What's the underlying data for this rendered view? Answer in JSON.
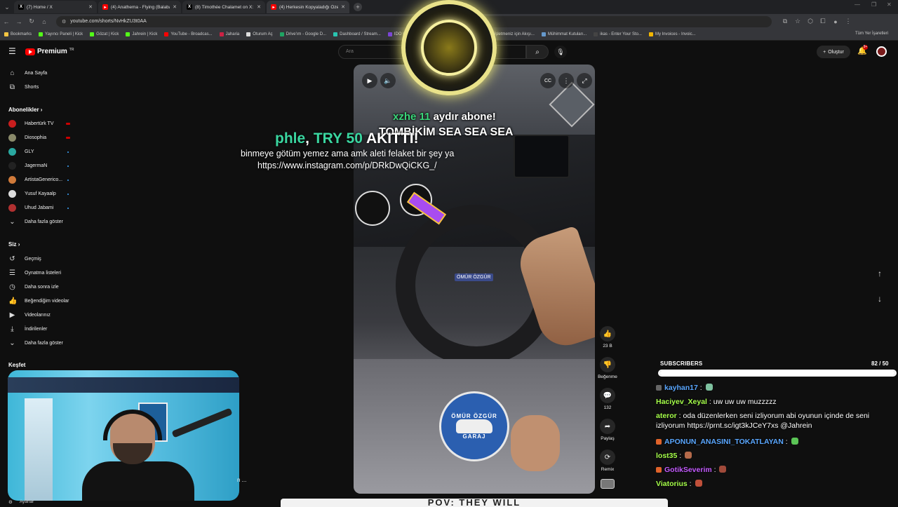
{
  "browser": {
    "tabs": [
      {
        "title": "(7) Home / X",
        "icon": "x-icon",
        "fav_color": "#000000"
      },
      {
        "title": "(4) Anathema - Flying (Balaban",
        "icon": "youtube-icon",
        "fav_color": "#ff0000"
      },
      {
        "title": "(8) Timothée Chalamet on X: \"I",
        "icon": "x-icon",
        "fav_color": "#000000"
      },
      {
        "title": "(4) Herkesin Kopyaladığı Özelli",
        "icon": "youtube-icon",
        "fav_color": "#ff0000"
      }
    ],
    "url": "youtube.com/shorts/NvHkZU3t0AA",
    "bookmarks": [
      {
        "label": "Bookmarks",
        "color": "#f4c542"
      },
      {
        "label": "Yayıncı Paneli | Kick",
        "color": "#53fc18"
      },
      {
        "label": "Gözat | Kick",
        "color": "#53fc18"
      },
      {
        "label": "Jahrein | Kick",
        "color": "#53fc18"
      },
      {
        "label": "YouTube - Broadcas...",
        "color": "#ff0000"
      },
      {
        "label": "Jaharia",
        "color": "#cc2244"
      },
      {
        "label": "Oturum Aç",
        "color": "#dddddd"
      },
      {
        "label": "Drive'ım - Google D...",
        "color": "#1fa463"
      },
      {
        "label": "Dashboard / Stream...",
        "color": "#29c4b0"
      },
      {
        "label": "IDO | SAVAŞÇI...",
        "color": "#7a44d8"
      },
      {
        "label": "Görsel Boyutlarını N...",
        "color": "#e8a33a"
      },
      {
        "label": "İşletmeniz için Akışı...",
        "color": "#dddddd"
      },
      {
        "label": "Mühimmat Kutuları...",
        "color": "#6699cc"
      },
      {
        "label": "ikas - Enter Your Sto...",
        "color": "#444444"
      },
      {
        "label": "My Invoices - Invoic...",
        "color": "#f2b600"
      }
    ],
    "all_bookmarks": "Tüm Yer İşaretleri"
  },
  "header": {
    "logo": "Premium",
    "logo_sup": "TR",
    "search_placeholder": "Ara",
    "create_label": "Oluştur",
    "notif_count": "9+"
  },
  "sidebar": {
    "main": [
      {
        "label": "Ana Sayfa",
        "icon": "home-icon",
        "glyph": "⌂"
      },
      {
        "label": "Shorts",
        "icon": "shorts-icon",
        "glyph": "⧉"
      }
    ],
    "subs_heading": "Abonelikler",
    "subs": [
      {
        "label": "Habertürk TV",
        "color": "#c81e1e",
        "live": true
      },
      {
        "label": "Diosophia",
        "color": "#8a8a6a",
        "live": true
      },
      {
        "label": "GLY",
        "color": "#2aa8a0",
        "live": false
      },
      {
        "label": "JagermaN",
        "color": "#222222",
        "live": false
      },
      {
        "label": "ArtistaGenerico...",
        "color": "#d07a3a",
        "live": false
      },
      {
        "label": "Yusuf Kayaalp",
        "color": "#dddddd",
        "live": false
      },
      {
        "label": "Uhud Jabami",
        "color": "#b03030",
        "live": false
      }
    ],
    "subs_more": "Daha fazla göster",
    "you_heading": "Siz",
    "you": [
      {
        "label": "Geçmiş",
        "icon": "history-icon",
        "glyph": "↺"
      },
      {
        "label": "Oynatma listeleri",
        "icon": "playlist-icon",
        "glyph": "☰"
      },
      {
        "label": "Daha sonra izle",
        "icon": "watch-later-icon",
        "glyph": "◷"
      },
      {
        "label": "Beğendiğim videolar",
        "icon": "like-icon",
        "glyph": "👍"
      },
      {
        "label": "Videolarınız",
        "icon": "your-videos-icon",
        "glyph": "▶"
      },
      {
        "label": "İndirilenler",
        "icon": "download-icon",
        "glyph": "⤓"
      }
    ],
    "you_more": "Daha fazla göster",
    "explore_heading": "Keşfet",
    "settings": "Ayarlar"
  },
  "short": {
    "overlay_badge": "ÖMÜR ÖZGÜR",
    "logo_top": "ÖMÜR ÖZGÜR",
    "logo_bottom": "GARAJ",
    "actions": [
      {
        "icon": "thumbs-up-icon",
        "glyph": "👍",
        "label": "23 B"
      },
      {
        "icon": "thumbs-down-icon",
        "glyph": "👎",
        "label": "Beğenme"
      },
      {
        "icon": "comment-icon",
        "glyph": "💬",
        "label": "132"
      },
      {
        "icon": "share-icon",
        "glyph": "➦",
        "label": "Paylaş"
      },
      {
        "icon": "remix-icon",
        "glyph": "⟳",
        "label": "Remix"
      }
    ]
  },
  "alerts": {
    "sub_name": "xzhe",
    "sub_months": "11",
    "sub_text": "aydır abone!",
    "sub_msg": "TOMBİKİM SEA SEA SEA",
    "donor": "phle",
    "amount": "TRY 50",
    "donation_suffix": "AKITTI!",
    "donation_msg": "binmeye götüm yemez ama amk aleti felaket bir şey ya",
    "donation_url": "https://www.instagram.com/p/DRkDwQiCKG_/"
  },
  "chat": {
    "sub_label": "SUBSCRIBERS",
    "sub_count": "82  / 50",
    "sub_progress": 1.0,
    "messages": [
      {
        "user": "kayhan17",
        "color": "#5aa7ff",
        "text": "",
        "badge": "#666666",
        "emote": "#7fc2a0"
      },
      {
        "user": "Haciyev_Xeyal",
        "color": "#a6ff4a",
        "text": "uw uw uw muzzzzz",
        "badge": "",
        "emote": ""
      },
      {
        "user": "ateror",
        "color": "#a6ff4a",
        "text": "oda düzenlerken seni izliyorum abi oyunun içinde de seni izliyorum https://prnt.sc/igt3kJCeY7xs @Jahrein",
        "badge": "",
        "emote": ""
      },
      {
        "user": "APONUN_ANASINI_TOKATLAYAN",
        "color": "#5aa7ff",
        "text": "",
        "badge": "#e0632a",
        "emote": "#5bc456"
      },
      {
        "user": "lost35",
        "color": "#a6ff4a",
        "text": "",
        "badge": "",
        "emote": "#b46a4a"
      },
      {
        "user": "GotikSeverim",
        "color": "#c45bff",
        "text": "",
        "badge": "#e0632a",
        "emote": "#a04a3a"
      },
      {
        "user": "Viatorius",
        "color": "#a6ff4a",
        "text": "",
        "badge": "",
        "emote": "#c0503a"
      }
    ]
  },
  "ticker": "POV: THEY WILL"
}
